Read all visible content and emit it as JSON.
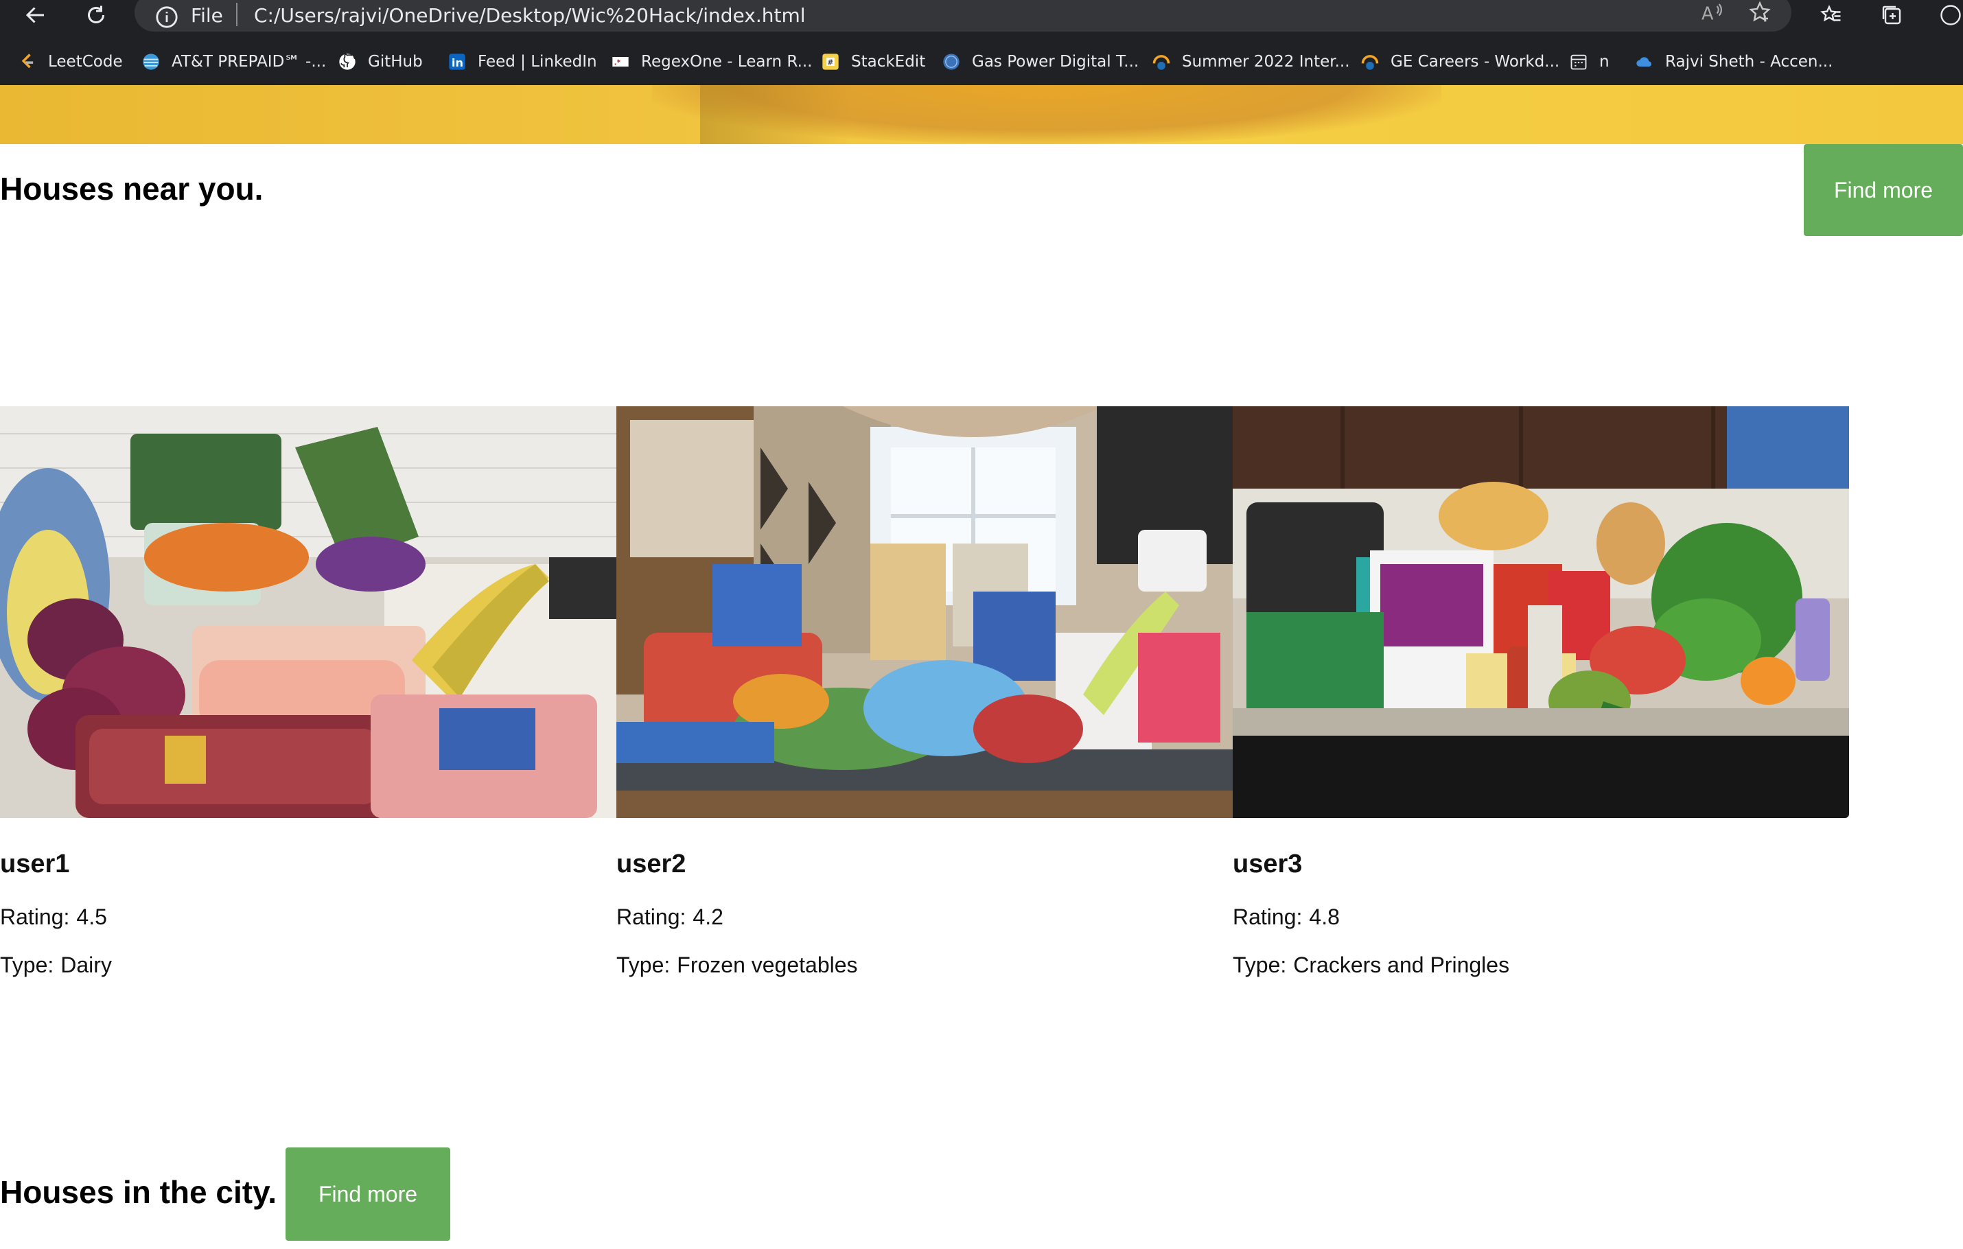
{
  "browser": {
    "address": {
      "scheme_label": "File",
      "url": "C:/Users/rajvi/OneDrive/Desktop/Wic%20Hack/index.html"
    },
    "bookmarks": [
      {
        "label": "LeetCode",
        "icon": "leetcode-icon"
      },
      {
        "label": "AT&T PREPAID℠ -...",
        "icon": "att-icon"
      },
      {
        "label": "GitHub",
        "icon": "github-icon"
      },
      {
        "label": "Feed | LinkedIn",
        "icon": "linkedin-icon"
      },
      {
        "label": "RegexOne - Learn R...",
        "icon": "regexone-icon"
      },
      {
        "label": "StackEdit",
        "icon": "stackedit-icon"
      },
      {
        "label": "Gas Power Digital T...",
        "icon": "ge-icon"
      },
      {
        "label": "Summer 2022 Inter...",
        "icon": "workday-icon"
      },
      {
        "label": "GE Careers - Workd...",
        "icon": "workday-icon"
      },
      {
        "label": "n",
        "icon": "calendar-icon"
      },
      {
        "label": "Rajvi Sheth - Accen...",
        "icon": "cloud-icon"
      }
    ]
  },
  "sections": {
    "near": {
      "title": "Houses near you.",
      "button": "Find more"
    },
    "city": {
      "title": "Houses in the city.",
      "button": "Find more"
    }
  },
  "cards": [
    {
      "user": "user1",
      "rating_label": "Rating:",
      "rating": "4.5",
      "type_label": "Type:",
      "type": "Dairy"
    },
    {
      "user": "user2",
      "rating_label": "Rating:",
      "rating": "4.2",
      "type_label": "Type:",
      "type": "Frozen vegetables"
    },
    {
      "user": "user3",
      "rating_label": "Rating:",
      "rating": "4.8",
      "type_label": "Type:",
      "type": "Crackers and Pringles"
    }
  ],
  "colors": {
    "button_green": "#66ad5b",
    "chrome_dark": "#202124",
    "hero_yellow": "#f1c540"
  }
}
